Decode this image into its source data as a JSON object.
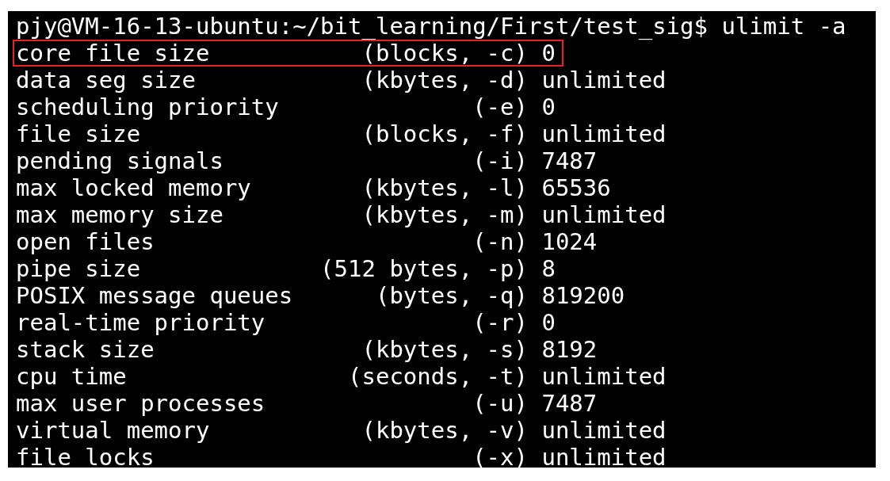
{
  "terminal": {
    "prompt": "pjy@VM-16-13-ubuntu:~/bit_learning/First/test_sig$",
    "command": "ulimit -a",
    "rows": [
      {
        "name": "core file size",
        "option": "(blocks, -c)",
        "value": "0",
        "highlighted": true
      },
      {
        "name": "data seg size",
        "option": "(kbytes, -d)",
        "value": "unlimited",
        "highlighted": false
      },
      {
        "name": "scheduling priority",
        "option": "(-e)",
        "value": "0",
        "highlighted": false
      },
      {
        "name": "file size",
        "option": "(blocks, -f)",
        "value": "unlimited",
        "highlighted": false
      },
      {
        "name": "pending signals",
        "option": "(-i)",
        "value": "7487",
        "highlighted": false
      },
      {
        "name": "max locked memory",
        "option": "(kbytes, -l)",
        "value": "65536",
        "highlighted": false
      },
      {
        "name": "max memory size",
        "option": "(kbytes, -m)",
        "value": "unlimited",
        "highlighted": false
      },
      {
        "name": "open files",
        "option": "(-n)",
        "value": "1024",
        "highlighted": false
      },
      {
        "name": "pipe size",
        "option": "(512 bytes, -p)",
        "value": "8",
        "highlighted": false
      },
      {
        "name": "POSIX message queues",
        "option": "(bytes, -q)",
        "value": "819200",
        "highlighted": false
      },
      {
        "name": "real-time priority",
        "option": "(-r)",
        "value": "0",
        "highlighted": false
      },
      {
        "name": "stack size",
        "option": "(kbytes, -s)",
        "value": "8192",
        "highlighted": false
      },
      {
        "name": "cpu time",
        "option": "(seconds, -t)",
        "value": "unlimited",
        "highlighted": false
      },
      {
        "name": "max user processes",
        "option": "(-u)",
        "value": "7487",
        "highlighted": false
      },
      {
        "name": "virtual memory",
        "option": "(kbytes, -v)",
        "value": "unlimited",
        "highlighted": false
      },
      {
        "name": "file locks",
        "option": "(-x)",
        "value": "unlimited",
        "highlighted": false
      }
    ]
  }
}
